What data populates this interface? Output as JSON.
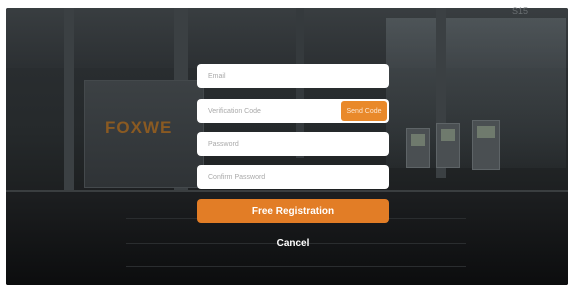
{
  "background": {
    "brand_text": "FOXWE",
    "corner_mark": "S15"
  },
  "form": {
    "email": {
      "placeholder": "Email",
      "value": ""
    },
    "verification_code": {
      "placeholder": "Verification Code",
      "value": ""
    },
    "send_code_label": "Send Code",
    "password": {
      "placeholder": "Password",
      "value": ""
    },
    "confirm_password": {
      "placeholder": "Confirm Password",
      "value": ""
    },
    "register_label": "Free Registration",
    "cancel_label": "Cancel"
  },
  "colors": {
    "accent": "#e27d26",
    "send_code_bg": "#e9892a",
    "field_bg": "#ffffff",
    "placeholder": "#a9a9a9"
  }
}
